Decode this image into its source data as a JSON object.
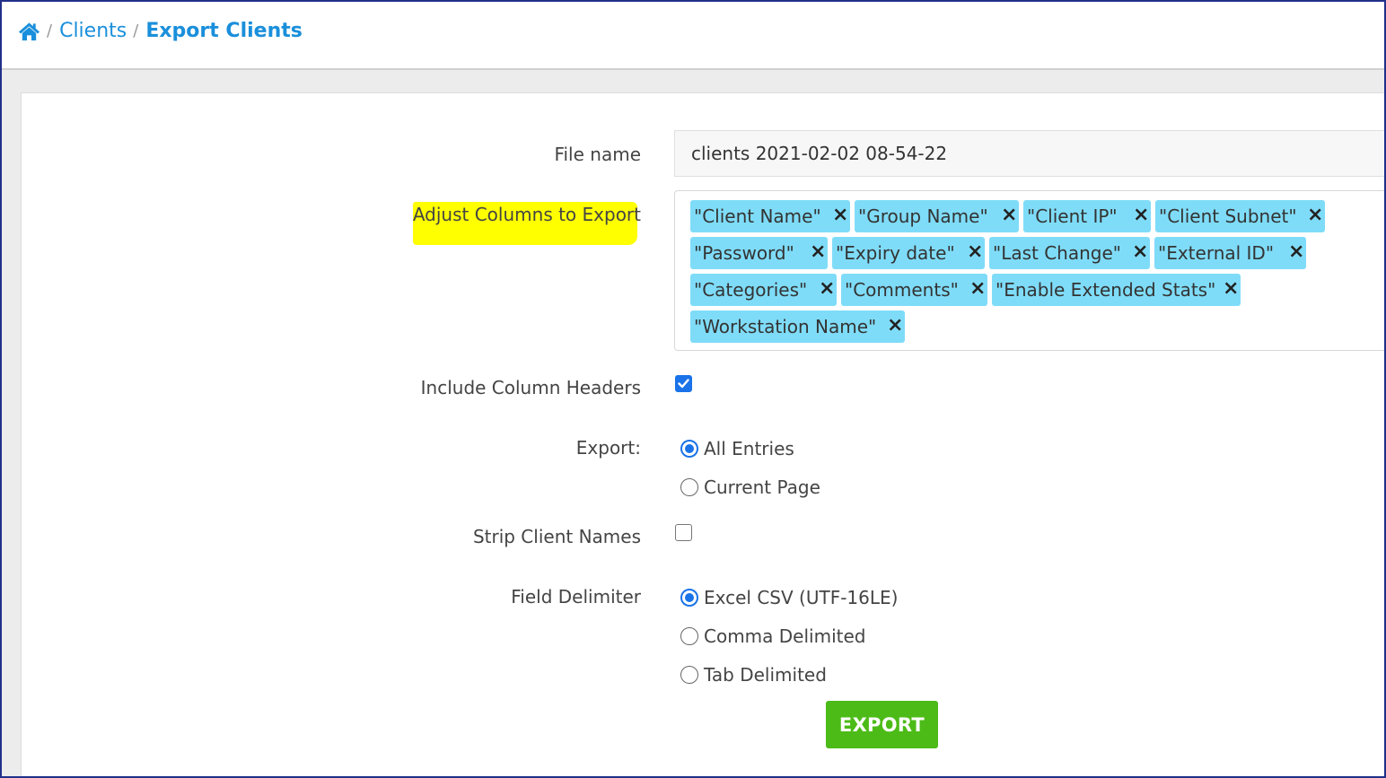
{
  "breadcrumb": {
    "home_icon": "home-icon",
    "items": [
      "Clients",
      "Export Clients"
    ]
  },
  "form": {
    "file_name": {
      "label": "File name",
      "value": "clients 2021-02-02 08-54-22"
    },
    "columns": {
      "label": "Adjust Columns to Export",
      "highlight_color": "#ffff00",
      "tags": [
        "\"Client Name\"",
        "\"Group Name\"",
        "\"Client IP\"",
        "\"Client Subnet\"",
        "\"Password\"",
        "\"Expiry date\"",
        "\"Last Change\"",
        "\"External ID\"",
        "\"Categories\"",
        "\"Comments\"",
        "\"Enable Extended Stats\"",
        "\"Workstation Name\""
      ],
      "tag_color": "#7fdcf8",
      "remove_symbol": "×"
    },
    "include_headers": {
      "label": "Include Column Headers",
      "checked": true
    },
    "export": {
      "label": "Export:",
      "options": [
        "All Entries",
        "Current Page"
      ],
      "selected": "All Entries"
    },
    "strip_names": {
      "label": "Strip Client Names",
      "checked": false
    },
    "delimiter": {
      "label": "Field Delimiter",
      "options": [
        "Excel CSV (UTF-16LE)",
        "Comma Delimited",
        "Tab Delimited"
      ],
      "selected": "Excel CSV (UTF-16LE)"
    },
    "submit_label": "EXPORT"
  },
  "colors": {
    "accent": "#1a8fdb",
    "checkbox": "#1a73e8",
    "button": "#4cbb17",
    "frame": "#22308a"
  }
}
